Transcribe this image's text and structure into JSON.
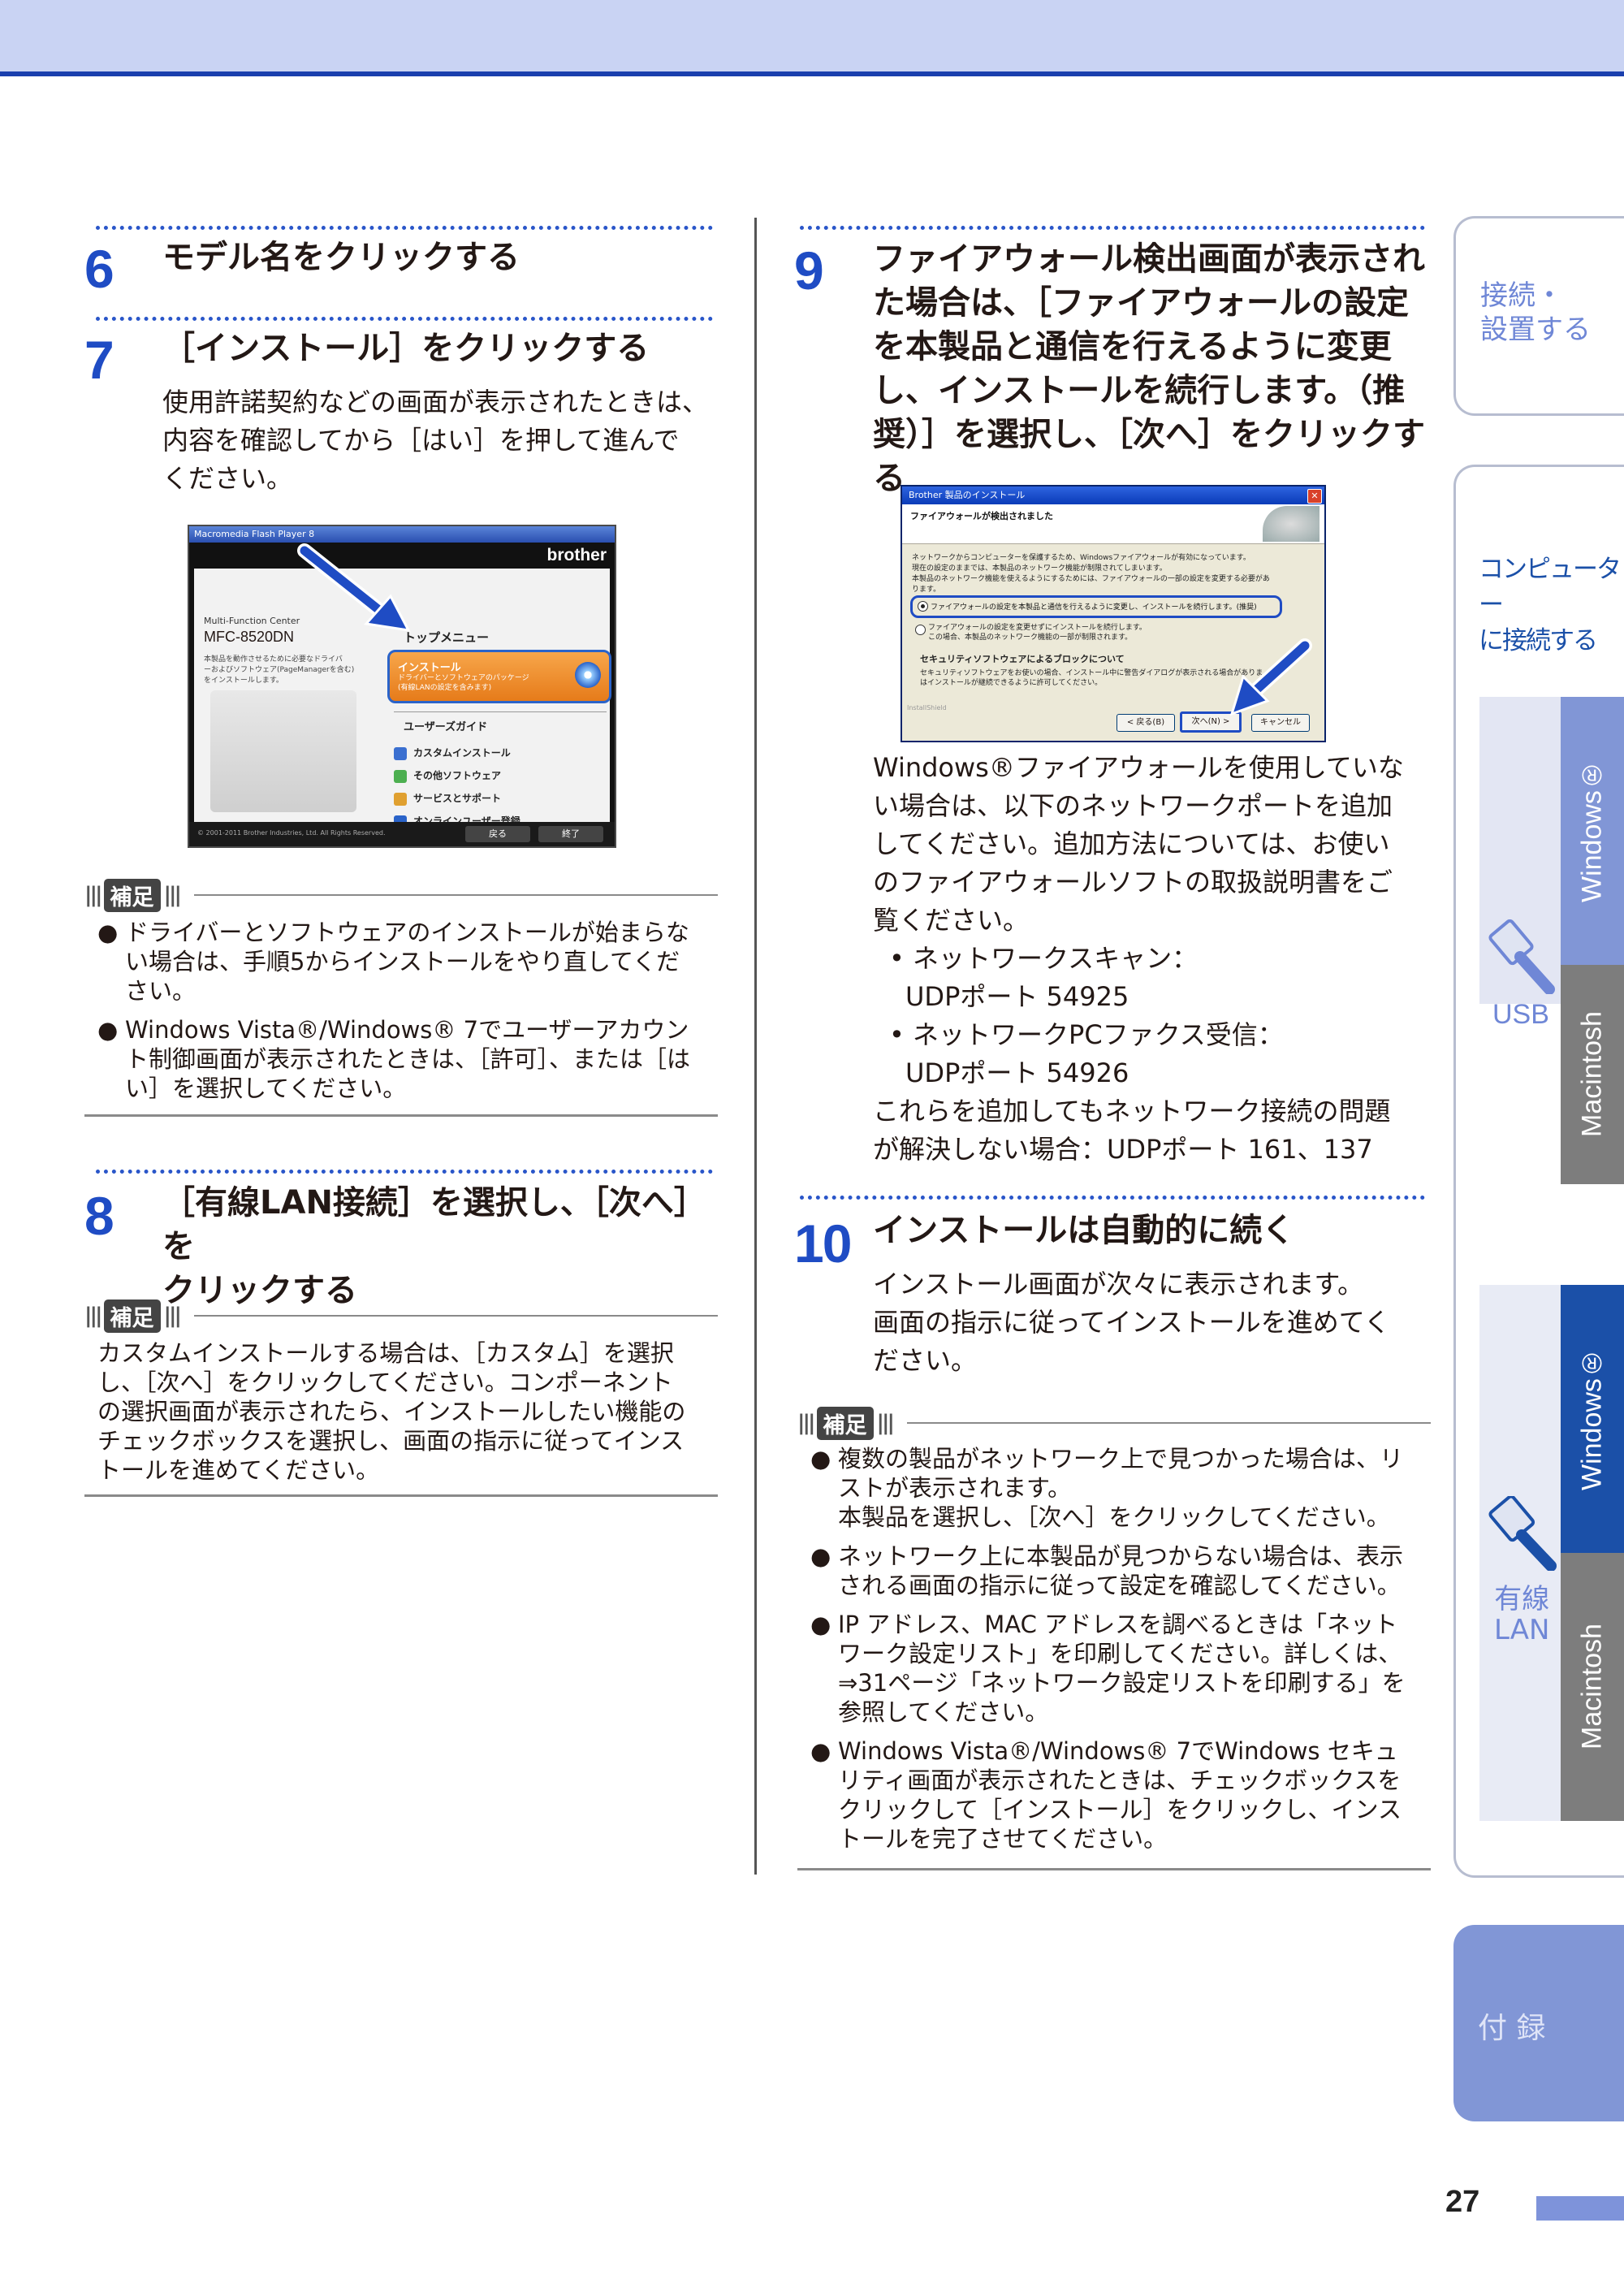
{
  "page_number": "27",
  "steps": {
    "s6": {
      "num": "6",
      "title": "モデル名をクリックする"
    },
    "s7": {
      "num": "7",
      "title": "［インストール］をクリックする",
      "body": [
        "使用許諾契約などの画面が表示されたときは、",
        "内容を確認してから［はい］を押して進んで",
        "ください。"
      ]
    },
    "s8": {
      "num": "8",
      "title": [
        "［有線LAN接続］を選択し、［次へ］を",
        "クリックする"
      ]
    },
    "s9": {
      "num": "9",
      "title": [
        "ファイアウォール検出画面が表示され",
        "た場合は、［ファイアウォールの設定",
        "を本製品と通信を行えるように変更",
        "し、インストールを続行します。（推",
        "奨）］を選択し、［次へ］をクリックする"
      ],
      "body_lines": [
        "Windows®ファイアウォールを使用していな",
        "い場合は、以下のネットワークポートを追加",
        "してください。追加方法については、お使い",
        "のファイアウォールソフトの取扱説明書をご",
        "覧ください。"
      ],
      "bullets": [
        {
          "label": "ネットワークスキャン：",
          "port": "UDPポート 54925"
        },
        {
          "label": "ネットワークPCファクス受信：",
          "port": "UDPポート 54926"
        }
      ],
      "tail": [
        "これらを追加してもネットワーク接続の問題",
        "が解決しない場合：UDPポート 161、137"
      ]
    },
    "s10": {
      "num": "10",
      "title": "インストールは自動的に続く",
      "body": [
        "インストール画面が次々に表示されます。",
        "画面の指示に従ってインストールを進めてく",
        "ださい。"
      ]
    }
  },
  "hosoku_label": "補足",
  "notes": {
    "n7": [
      {
        "bullet": "●",
        "lines": [
          "ドライバーとソフトウェアのインストールが始まらな",
          "い場合は、手順5からインストールをやり直してくだ",
          "さい。"
        ]
      },
      {
        "bullet": "●",
        "lines": [
          "Windows Vista®/Windows® 7でユーザーアカウン",
          "ト制御画面が表示されたときは、［許可］、または［は",
          "い］を選択してください。"
        ]
      }
    ],
    "n8": [
      "カスタムインストールする場合は、［カスタム］を選択",
      "し、［次へ］をクリックしてください。コンポーネント",
      "の選択画面が表示されたら、インストールしたい機能の",
      "チェックボックスを選択し、画面の指示に従ってインス",
      "トールを進めてください。"
    ],
    "n10": [
      {
        "bullet": "●",
        "lines": [
          "複数の製品がネットワーク上で見つかった場合は、リ",
          "ストが表示されます。",
          "本製品を選択し、［次へ］をクリックしてください。"
        ]
      },
      {
        "bullet": "●",
        "lines": [
          "ネットワーク上に本製品が見つからない場合は、表示",
          "される画面の指示に従って設定を確認してください。"
        ]
      },
      {
        "bullet": "●",
        "lines": [
          "IP アドレス、MAC アドレスを調べるときは「ネット",
          "ワーク設定リスト」を印刷してください。詳しくは、",
          "⇒31ページ「ネットワーク設定リストを印刷する」を",
          "参照してください。"
        ]
      },
      {
        "bullet": "●",
        "lines": [
          "Windows Vista®/Windows® 7でWindows セキュ",
          "リティ画面が表示されたときは、チェックボックスを",
          "クリックして［インストール］をクリックし、インス",
          "トールを完了させてください。"
        ]
      }
    ]
  },
  "screenshot1": {
    "titlebar": "Macromedia Flash Player 8",
    "brand": "brother",
    "subtitle": "Multi-Function Center",
    "model": "MFC-8520DN",
    "desc": [
      "本製品を動作させるために必要なドライバ",
      "ーおよびソフトウェア(PageManagerを含む)",
      "をインストールします。"
    ],
    "topmenu": "トップメニュー",
    "install_title": "インストール",
    "install_sub": [
      "ドライバーとソフトウェアのパッケージ",
      "(有線LANの設定を含みます)"
    ],
    "guide": "ユーザーズガイド",
    "items": [
      "カスタムインストール",
      "その他ソフトウェア",
      "サービスとサポート",
      "オンラインユーザー登録"
    ],
    "copyright": "© 2001-2011 Brother Industries, Ltd. All Rights Reserved.",
    "back": "戻る",
    "exit": "終了"
  },
  "screenshot2": {
    "titlebar": "Brother 製品のインストール",
    "header": "ファイアウォールが検出されました",
    "para": [
      "ネットワークからコンピューターを保護するため、Windowsファイアウォールが有効になっています。",
      "現在の設定のままでは、本製品のネットワーク機能が制限されてしまいます。",
      "本製品のネットワーク機能を使えるようにするためには、ファイアウォールの一部の設定を変更する必要があ",
      "ります。"
    ],
    "option1": "ファイアウォールの設定を本製品と通信を行えるように変更し、インストールを続行します。(推奨)",
    "option2": [
      "ファイアウォールの設定を変更せずにインストールを続行します。",
      "この場合、本製品のネットワーク機能の一部が制限されます。"
    ],
    "sec_title": "セキュリティソフトウェアによるブロックについて",
    "sec_para": [
      "セキュリティソフトウェアをお使いの場合、インストール中に警告ダイアログが表示される場合がありま",
      "はインストールが継続できるように許可してください。"
    ],
    "shield": "InstallShield",
    "btn_back": "< 戻る(B)",
    "btn_next": "次へ(N) >",
    "btn_cancel": "キャンセル"
  },
  "sidetabs": {
    "t1": [
      "接続・",
      "設置する"
    ],
    "t2": [
      "コンピューター",
      "に接続する"
    ],
    "usb": "USB",
    "lan": [
      "有線",
      "LAN"
    ],
    "windows": "Windows®",
    "macintosh": "Macintosh",
    "appendix": "付 録"
  },
  "colors": {
    "accent": "#1f4cc4",
    "tab_blue": "#8196d6",
    "tab_dark": "#1b50a8",
    "tab_gray": "#7d7d7d",
    "top_band": "#c9d3f3"
  }
}
